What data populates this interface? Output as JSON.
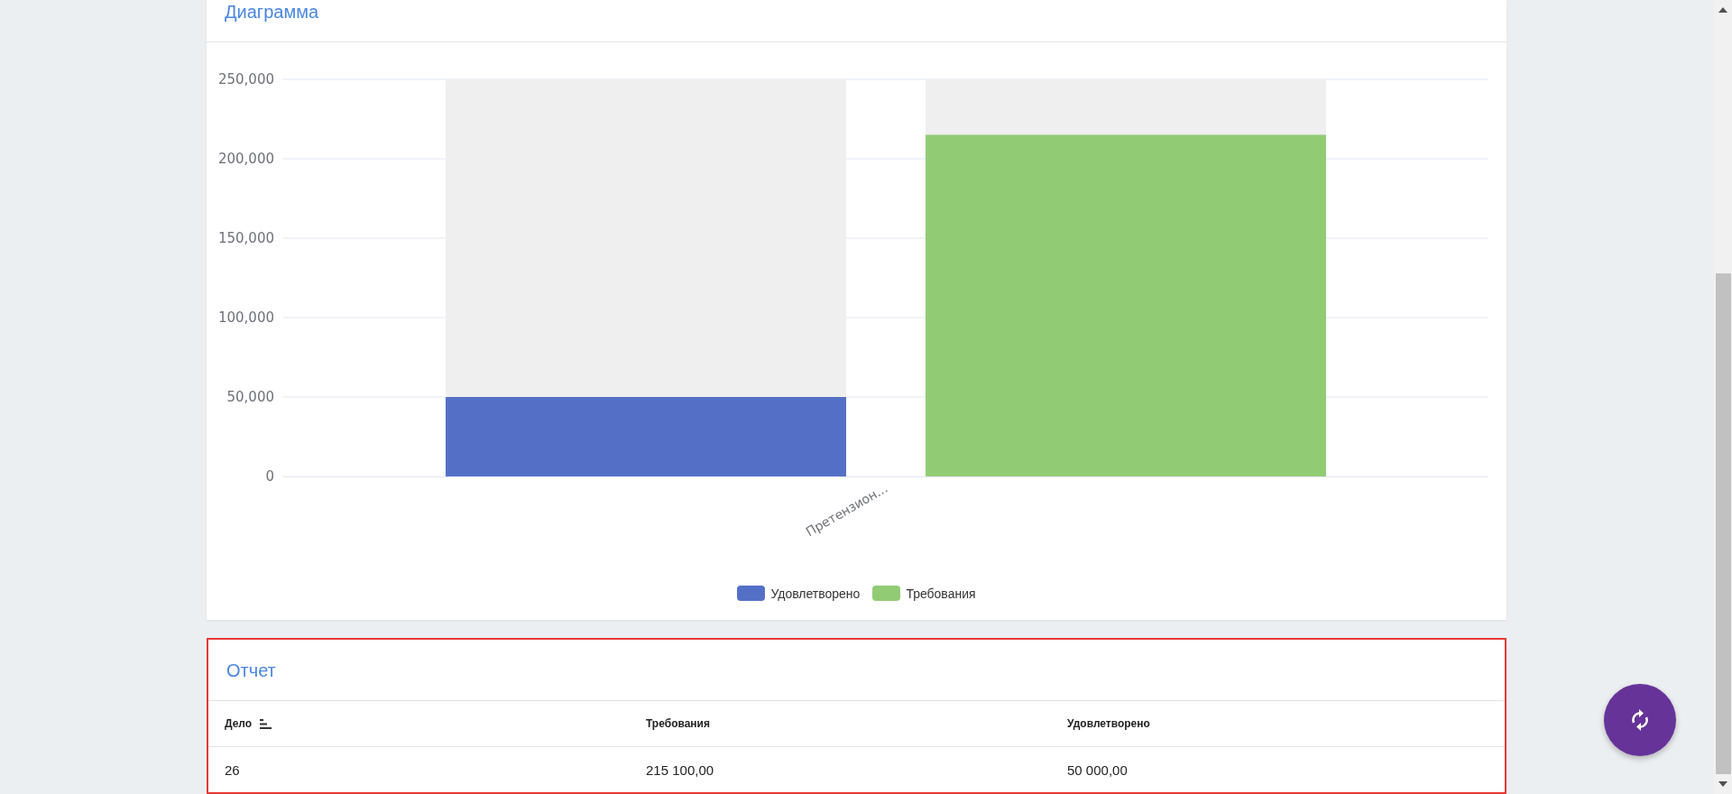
{
  "diagram": {
    "title": "Диаграмма",
    "chart_data": {
      "type": "bar",
      "grid": true,
      "categories": [
        "Претензион..."
      ],
      "series": [
        {
          "name": "Удовлетворено",
          "color": "#5470c6",
          "values": [
            50000
          ]
        },
        {
          "name": "Требования",
          "color": "#91cc75",
          "values": [
            215100
          ]
        }
      ],
      "ylim": [
        0,
        250000
      ],
      "yticks": [
        {
          "value": 0,
          "label": "0"
        },
        {
          "value": 50000,
          "label": "50,000"
        },
        {
          "value": 100000,
          "label": "100,000"
        },
        {
          "value": 150000,
          "label": "150,000"
        },
        {
          "value": 200000,
          "label": "200,000"
        },
        {
          "value": 250000,
          "label": "250,000"
        }
      ]
    }
  },
  "report": {
    "title": "Отчет",
    "selected": true,
    "columns": [
      {
        "label": "Дело",
        "sorted": true
      },
      {
        "label": "Требования",
        "sorted": false
      },
      {
        "label": "Удовлетворено",
        "sorted": false
      }
    ],
    "rows": [
      [
        "26",
        "215 100,00",
        "50 000,00"
      ]
    ]
  }
}
